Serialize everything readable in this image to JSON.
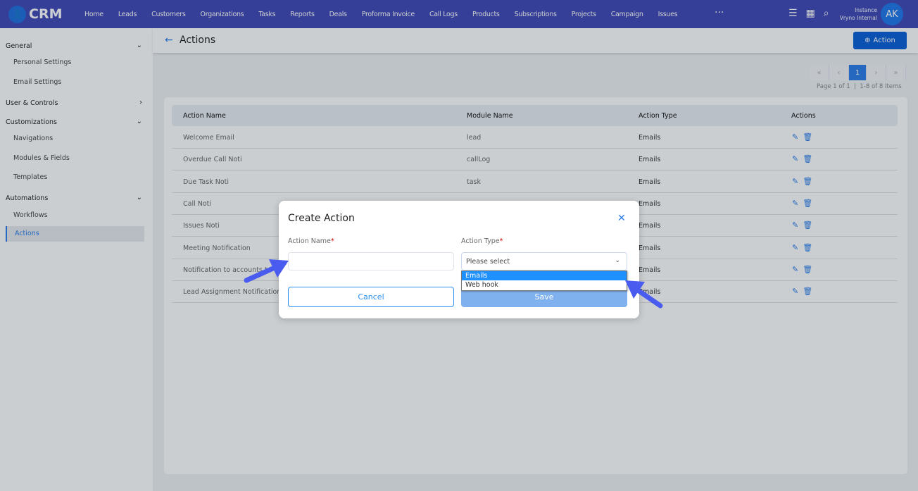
{
  "app": {
    "name": "CRM",
    "nav": [
      "Home",
      "Leads",
      "Customers",
      "Organizations",
      "Tasks",
      "Reports",
      "Deals",
      "Proforma Invoice",
      "Call Logs",
      "Products",
      "Subscriptions",
      "Projects",
      "Campaign",
      "Issues"
    ],
    "more": "···",
    "instance_label": "Instance",
    "instance_name": "Vryno Internal",
    "avatar": "AK"
  },
  "sidebar": {
    "general": "General",
    "personal_settings": "Personal Settings",
    "email_settings": "Email Settings",
    "user_controls": "User & Controls",
    "customizations": "Customizations",
    "navigations": "Navigations",
    "modules_fields": "Modules & Fields",
    "templates": "Templates",
    "automations": "Automations",
    "workflows": "Workflows",
    "actions": "Actions"
  },
  "page": {
    "title": "Actions",
    "add_button": "Action",
    "pager": {
      "current": "1",
      "info": "Page 1 of 1  |  1-8 of 8 Items"
    }
  },
  "table": {
    "headers": [
      "Action Name",
      "Module Name",
      "Action Type",
      "Actions"
    ],
    "rows": [
      {
        "name": "Welcome Email",
        "module": "lead",
        "type": "Emails"
      },
      {
        "name": "Overdue Call Noti",
        "module": "callLog",
        "type": "Emails"
      },
      {
        "name": "Due Task Noti",
        "module": "task",
        "type": "Emails"
      },
      {
        "name": "Call Noti",
        "module": "",
        "type": "Emails"
      },
      {
        "name": "Issues Noti",
        "module": "",
        "type": "Emails"
      },
      {
        "name": "Meeting Notification",
        "module": "",
        "type": "Emails"
      },
      {
        "name": "Notification to accounts te",
        "module": "",
        "type": "Emails"
      },
      {
        "name": "Lead Assignment Notification",
        "module": "",
        "type": "Emails"
      }
    ]
  },
  "modal": {
    "title": "Create Action",
    "action_name_label": "Action Name",
    "action_type_label": "Action Type",
    "required": "*",
    "select_placeholder": "Please select",
    "options": [
      "Emails",
      "Web hook"
    ],
    "cancel": "Cancel",
    "save": "Save"
  },
  "colors": {
    "topbar": "#3f48b8",
    "accent": "#2b7de9",
    "annotation_arrow": "#4a5cf0"
  }
}
